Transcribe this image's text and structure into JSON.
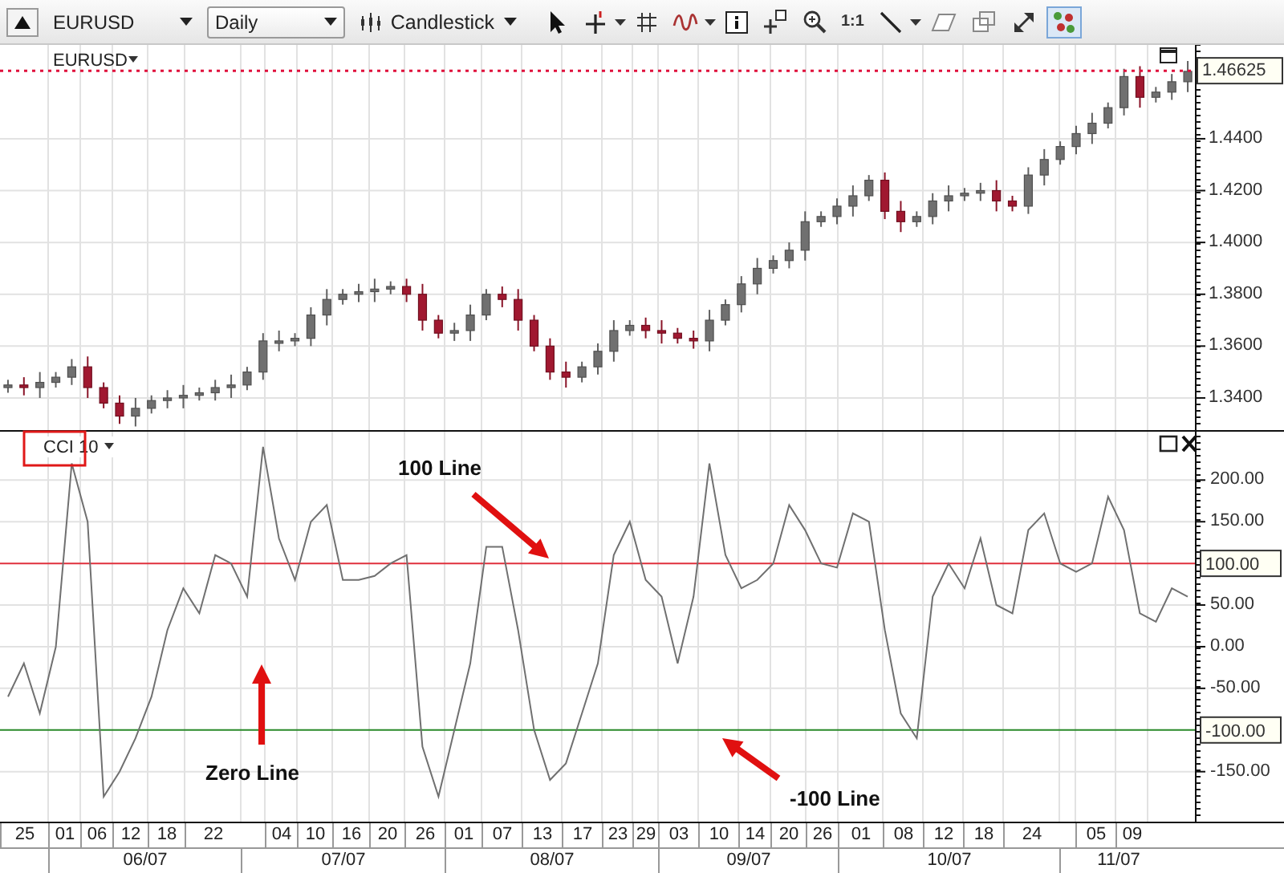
{
  "toolbar": {
    "collapsed": false,
    "symbol": "EURUSD",
    "period": "Daily",
    "chart_type": "Candlestick",
    "tools": [
      {
        "kind": "pointer",
        "menu": false,
        "selected": false
      },
      {
        "kind": "crosshair",
        "menu": true,
        "selected": false
      },
      {
        "kind": "grid",
        "menu": false,
        "selected": false
      },
      {
        "kind": "wave",
        "menu": true,
        "selected": false
      },
      {
        "kind": "info",
        "menu": false,
        "selected": false
      },
      {
        "kind": "add-panel",
        "menu": false,
        "selected": false
      },
      {
        "kind": "zoom",
        "menu": false,
        "selected": false
      },
      {
        "kind": "text",
        "label": "1:1",
        "menu": false,
        "selected": false
      },
      {
        "kind": "line",
        "menu": true,
        "selected": false
      },
      {
        "kind": "eraser",
        "menu": false,
        "selected": false
      },
      {
        "kind": "layers",
        "menu": false,
        "selected": false
      },
      {
        "kind": "expand",
        "menu": false,
        "selected": false
      },
      {
        "kind": "dots",
        "menu": false,
        "selected": true
      }
    ]
  },
  "price_panel": {
    "label": "EURUSD",
    "chart_data": {
      "type": "candlestick",
      "grid": true,
      "ylim": [
        1.3276,
        1.4762
      ],
      "yticks": [
        {
          "value": 1.34,
          "label": "1.3400"
        },
        {
          "value": 1.36,
          "label": "1.3600"
        },
        {
          "value": 1.38,
          "label": "1.3800"
        },
        {
          "value": 1.4,
          "label": "1.4000"
        },
        {
          "value": 1.42,
          "label": "1.4200"
        },
        {
          "value": 1.44,
          "label": "1.4400"
        }
      ],
      "ohlc": [
        [
          1.344,
          1.347,
          1.342,
          1.345
        ],
        [
          1.345,
          1.348,
          1.341,
          1.344
        ],
        [
          1.344,
          1.35,
          1.34,
          1.346
        ],
        [
          1.346,
          1.35,
          1.344,
          1.348
        ],
        [
          1.348,
          1.355,
          1.345,
          1.352
        ],
        [
          1.352,
          1.356,
          1.34,
          1.344
        ],
        [
          1.344,
          1.346,
          1.336,
          1.338
        ],
        [
          1.338,
          1.341,
          1.33,
          1.333
        ],
        [
          1.333,
          1.34,
          1.329,
          1.336
        ],
        [
          1.336,
          1.341,
          1.334,
          1.339
        ],
        [
          1.339,
          1.343,
          1.336,
          1.34
        ],
        [
          1.34,
          1.345,
          1.336,
          1.341
        ],
        [
          1.341,
          1.344,
          1.339,
          1.342
        ],
        [
          1.342,
          1.347,
          1.339,
          1.344
        ],
        [
          1.344,
          1.349,
          1.34,
          1.345
        ],
        [
          1.345,
          1.352,
          1.343,
          1.35
        ],
        [
          1.35,
          1.365,
          1.347,
          1.362
        ],
        [
          1.362,
          1.366,
          1.358,
          1.362
        ],
        [
          1.362,
          1.365,
          1.36,
          1.363
        ],
        [
          1.363,
          1.375,
          1.36,
          1.372
        ],
        [
          1.372,
          1.382,
          1.368,
          1.378
        ],
        [
          1.378,
          1.382,
          1.376,
          1.38
        ],
        [
          1.38,
          1.384,
          1.377,
          1.381
        ],
        [
          1.381,
          1.386,
          1.377,
          1.382
        ],
        [
          1.382,
          1.385,
          1.38,
          1.383
        ],
        [
          1.383,
          1.386,
          1.377,
          1.38
        ],
        [
          1.38,
          1.384,
          1.366,
          1.37
        ],
        [
          1.37,
          1.372,
          1.363,
          1.365
        ],
        [
          1.365,
          1.369,
          1.362,
          1.366
        ],
        [
          1.366,
          1.376,
          1.362,
          1.372
        ],
        [
          1.372,
          1.382,
          1.37,
          1.38
        ],
        [
          1.38,
          1.383,
          1.375,
          1.378
        ],
        [
          1.378,
          1.382,
          1.366,
          1.37
        ],
        [
          1.37,
          1.372,
          1.358,
          1.36
        ],
        [
          1.36,
          1.363,
          1.347,
          1.35
        ],
        [
          1.35,
          1.354,
          1.344,
          1.348
        ],
        [
          1.348,
          1.354,
          1.346,
          1.352
        ],
        [
          1.352,
          1.361,
          1.349,
          1.358
        ],
        [
          1.358,
          1.37,
          1.354,
          1.366
        ],
        [
          1.366,
          1.37,
          1.364,
          1.368
        ],
        [
          1.368,
          1.371,
          1.363,
          1.366
        ],
        [
          1.366,
          1.37,
          1.361,
          1.365
        ],
        [
          1.365,
          1.367,
          1.361,
          1.363
        ],
        [
          1.363,
          1.366,
          1.359,
          1.362
        ],
        [
          1.362,
          1.374,
          1.358,
          1.37
        ],
        [
          1.37,
          1.378,
          1.368,
          1.376
        ],
        [
          1.376,
          1.387,
          1.373,
          1.384
        ],
        [
          1.384,
          1.394,
          1.38,
          1.39
        ],
        [
          1.39,
          1.395,
          1.388,
          1.393
        ],
        [
          1.393,
          1.4,
          1.39,
          1.397
        ],
        [
          1.397,
          1.412,
          1.393,
          1.408
        ],
        [
          1.408,
          1.412,
          1.406,
          1.41
        ],
        [
          1.41,
          1.417,
          1.407,
          1.414
        ],
        [
          1.414,
          1.422,
          1.41,
          1.418
        ],
        [
          1.418,
          1.426,
          1.416,
          1.424
        ],
        [
          1.424,
          1.427,
          1.409,
          1.412
        ],
        [
          1.412,
          1.416,
          1.404,
          1.408
        ],
        [
          1.408,
          1.412,
          1.406,
          1.41
        ],
        [
          1.41,
          1.419,
          1.407,
          1.416
        ],
        [
          1.416,
          1.422,
          1.412,
          1.418
        ],
        [
          1.418,
          1.421,
          1.416,
          1.419
        ],
        [
          1.419,
          1.423,
          1.416,
          1.42
        ],
        [
          1.42,
          1.424,
          1.412,
          1.416
        ],
        [
          1.416,
          1.418,
          1.412,
          1.414
        ],
        [
          1.414,
          1.429,
          1.411,
          1.426
        ],
        [
          1.426,
          1.436,
          1.422,
          1.432
        ],
        [
          1.432,
          1.439,
          1.43,
          1.437
        ],
        [
          1.437,
          1.445,
          1.434,
          1.442
        ],
        [
          1.442,
          1.45,
          1.438,
          1.446
        ],
        [
          1.446,
          1.454,
          1.444,
          1.452
        ],
        [
          1.452,
          1.467,
          1.449,
          1.464
        ],
        [
          1.464,
          1.468,
          1.452,
          1.456
        ],
        [
          1.456,
          1.46,
          1.454,
          1.458
        ],
        [
          1.458,
          1.465,
          1.455,
          1.462
        ],
        [
          1.462,
          1.47,
          1.458,
          1.466
        ]
      ],
      "ref_lines": [
        {
          "axis": "y",
          "value": 1.46625,
          "label": "1.46625",
          "color": "#e0103c"
        }
      ]
    }
  },
  "cci_panel": {
    "highlighted": true,
    "chart_data": {
      "type": "line",
      "grid": true,
      "ylim": [
        -210,
        260
      ],
      "yticks": [
        {
          "value": 200,
          "label": "200.00"
        },
        {
          "value": 150,
          "label": "150.00"
        },
        {
          "value": 50,
          "label": "50.00"
        },
        {
          "value": 0,
          "label": "0.00"
        },
        {
          "value": -50,
          "label": "-50.00"
        },
        {
          "value": -150,
          "label": "-150.00"
        }
      ],
      "series": [
        {
          "name": "CCI 10",
          "color": "#707070",
          "values": [
            -60,
            -20,
            -80,
            0,
            220,
            150,
            -180,
            -150,
            -110,
            -60,
            20,
            70,
            40,
            110,
            100,
            60,
            240,
            130,
            80,
            150,
            170,
            80,
            80,
            85,
            100,
            110,
            -120,
            -180,
            -100,
            -20,
            120,
            120,
            20,
            -100,
            -160,
            -140,
            -80,
            -20,
            110,
            150,
            80,
            60,
            -20,
            60,
            220,
            110,
            70,
            80,
            100,
            170,
            140,
            100,
            95,
            160,
            150,
            20,
            -80,
            -110,
            60,
            100,
            70,
            130,
            50,
            40,
            140,
            160,
            100,
            90,
            100,
            180,
            140,
            40,
            30,
            70,
            60
          ]
        }
      ],
      "ref_lines": [
        {
          "axis": "y",
          "value": 100,
          "label": "100.00",
          "color": "#e0303c"
        },
        {
          "axis": "y",
          "value": -100,
          "label": "-100.00",
          "color": "#2a8a2a"
        }
      ]
    },
    "callouts": [
      {
        "text": "100 Line"
      },
      {
        "text": "Zero Line"
      },
      {
        "text": "-100 Line"
      }
    ]
  },
  "date_axis": {
    "days": [
      "25",
      "01",
      "06",
      "12",
      "18",
      "22",
      "04",
      "10",
      "16",
      "20",
      "26",
      "01",
      "07",
      "13",
      "17",
      "23",
      "29",
      "03",
      "10",
      "14",
      "20",
      "26",
      "01",
      "08",
      "12",
      "18",
      "24",
      "05",
      "09"
    ],
    "months": [
      "06/07",
      "07/07",
      "08/07",
      "09/07",
      "10/07",
      "11/07"
    ]
  }
}
